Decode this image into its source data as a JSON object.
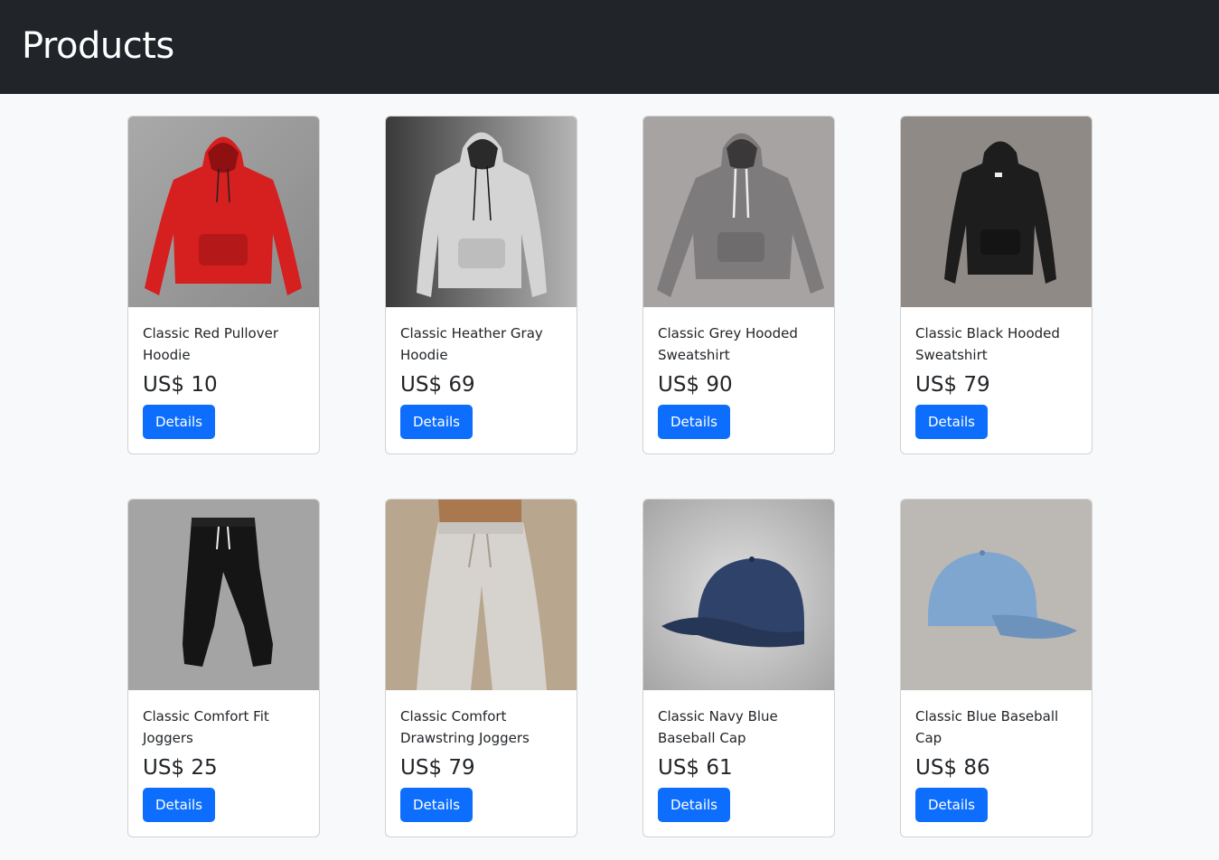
{
  "header": {
    "title": "Products"
  },
  "colors": {
    "header_bg": "#212529",
    "page_bg": "#f8f9fa",
    "button": "#0d6efd"
  },
  "products": [
    {
      "title": "Classic Red Pullover Hoodie",
      "price": "US$ 10",
      "button": "Details",
      "image": "red-hoodie"
    },
    {
      "title": "Classic Heather Gray Hoodie",
      "price": "US$ 69",
      "button": "Details",
      "image": "heather-gray-hoodie"
    },
    {
      "title": "Classic Grey Hooded Sweatshirt",
      "price": "US$ 90",
      "button": "Details",
      "image": "grey-hoodie"
    },
    {
      "title": "Classic Black Hooded Sweatshirt",
      "price": "US$ 79",
      "button": "Details",
      "image": "black-hoodie"
    },
    {
      "title": "Classic Comfort Fit Joggers",
      "price": "US$ 25",
      "button": "Details",
      "image": "black-joggers"
    },
    {
      "title": "Classic Comfort Drawstring Joggers",
      "price": "US$ 79",
      "button": "Details",
      "image": "beige-joggers"
    },
    {
      "title": "Classic Navy Blue Baseball Cap",
      "price": "US$ 61",
      "button": "Details",
      "image": "navy-cap"
    },
    {
      "title": "Classic Blue Baseball Cap",
      "price": "US$ 86",
      "button": "Details",
      "image": "light-blue-cap"
    }
  ]
}
